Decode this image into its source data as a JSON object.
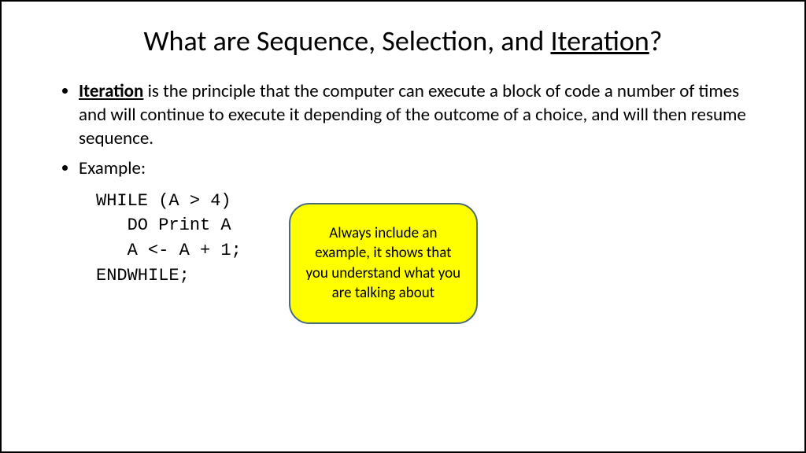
{
  "title": {
    "pre": "What are Sequence, Selection, and ",
    "underlined": "Iteration",
    "post": "?"
  },
  "bullets": {
    "definition": {
      "term": "Iteration",
      "rest": " is the principle that the computer can execute a block of code a number of times and will continue to execute it depending of the outcome of a choice, and will then resume sequence."
    },
    "example_label": "Example:"
  },
  "code": "WHILE (A > 4)\n   DO Print A\n   A <- A + 1;\nENDWHILE;",
  "callout": "Always include an example, it shows that you understand what you are talking about"
}
